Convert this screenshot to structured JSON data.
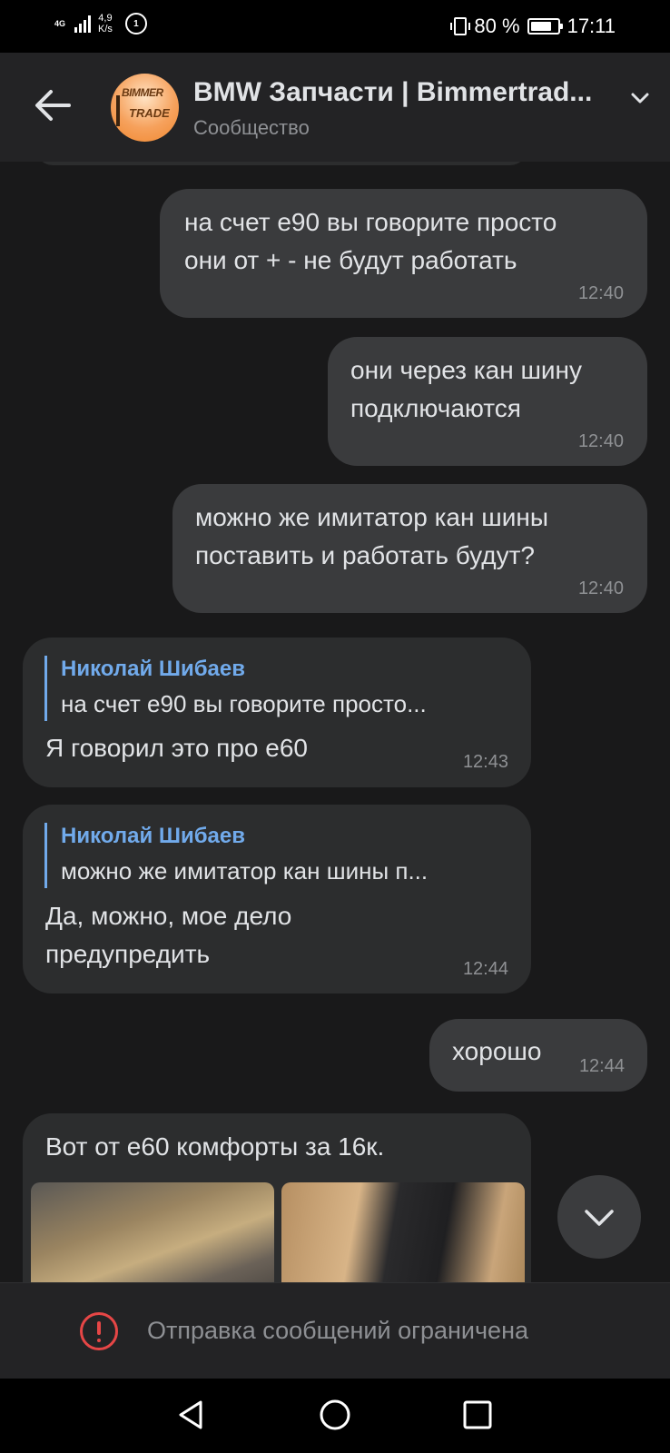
{
  "status_bar": {
    "network": "4G",
    "speed_value": "4,9",
    "speed_unit": "K/s",
    "badge": "1",
    "battery": "80 %",
    "battery_level": 0.8,
    "time": "17:11"
  },
  "header": {
    "title": "BMW Запчасти | Bimmertrad...",
    "subtitle": "Сообщество",
    "avatar_logo_top": "BIMMER",
    "avatar_logo_bottom": "TRADE"
  },
  "messages": [
    {
      "type": "out",
      "lines": [
        "на счет е90 вы говорите просто",
        "они от + - не будут работать"
      ],
      "time": "12:40"
    },
    {
      "type": "out",
      "lines": [
        "они через кан шину",
        "подключаются"
      ],
      "time": "12:40"
    },
    {
      "type": "out",
      "lines": [
        "можно же имитатор кан шины",
        "поставить и работать будут?"
      ],
      "time": "12:40"
    },
    {
      "type": "in",
      "reply_name": "Николай Шибаев",
      "reply_text": "на счет е90 вы говорите просто...",
      "lines": [
        "Я говорил это про е60"
      ],
      "time": "12:43"
    },
    {
      "type": "in",
      "reply_name": "Николай Шибаев",
      "reply_text": "можно же имитатор кан шины п...",
      "lines": [
        "Да, можно, мое дело",
        "предупредить"
      ],
      "time": "12:44"
    },
    {
      "type": "out",
      "lines": [
        "хорошо"
      ],
      "time": "12:44"
    },
    {
      "type": "in",
      "lines": [
        "Вот от е60 комфорты за 16к."
      ],
      "photos": 2
    }
  ],
  "restriction": {
    "text": "Отправка сообщений ограничена"
  },
  "colors": {
    "background": "#19191a",
    "header": "#232325",
    "bubble_out": "#3a3b3d",
    "bubble_in": "#2c2d2e",
    "accent": "#71aaeb",
    "warning": "#e64646"
  },
  "icons": {
    "back": "arrow-left-icon",
    "dropdown": "chevron-down-icon",
    "scroll_down": "chevron-down-icon",
    "warning": "exclamation-circle-icon",
    "nav_back": "triangle-back-icon",
    "nav_home": "circle-home-icon",
    "nav_recents": "square-recents-icon"
  }
}
